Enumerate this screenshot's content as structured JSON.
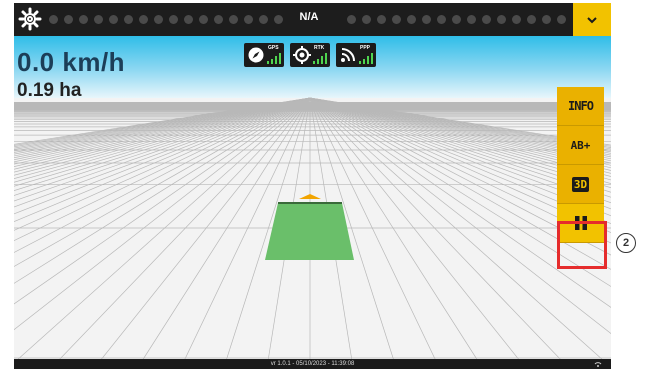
{
  "status": {
    "text": "N/A"
  },
  "display": {
    "speed": "0.0 km/h",
    "area": "0.19 ha"
  },
  "signals": [
    {
      "name": "GPS",
      "icon": "compass-icon"
    },
    {
      "name": "RTK",
      "icon": "crosshair-icon"
    },
    {
      "name": "PPP",
      "icon": "satellite-icon"
    }
  ],
  "sidebar": {
    "info": "INFO",
    "ab": "AB+",
    "view3d": "3D",
    "pause_icon": "pause-icon"
  },
  "callout": {
    "number": "2"
  },
  "footer": {
    "version": "vr 1.0.1 - 05/10/2023 - 11:39:08"
  },
  "colors": {
    "accent": "#f2c200",
    "sidebar": "#eab100",
    "highlight": "#e52c2c",
    "sky_top": "#2fbde8",
    "field": "#6abf6a",
    "speed_text": "#1c3e58"
  }
}
